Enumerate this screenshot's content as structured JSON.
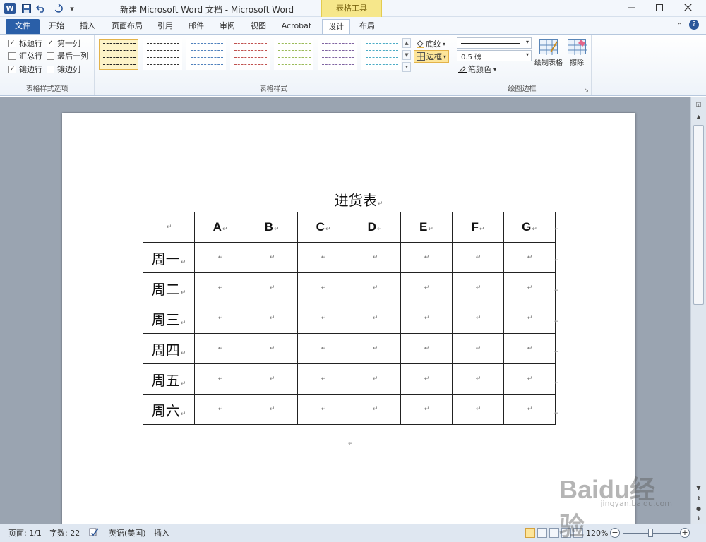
{
  "titlebar": {
    "title": "新建 Microsoft Word 文档 - Microsoft Word",
    "context_tab_group": "表格工具",
    "word_icon": "W",
    "qat_icons": [
      "save-icon",
      "undo-icon",
      "redo-icon",
      "customize-qat-icon"
    ]
  },
  "tabs": {
    "file": "文件",
    "home": "开始",
    "insert": "插入",
    "page_layout": "页面布局",
    "references": "引用",
    "mailings": "邮件",
    "review": "审阅",
    "view": "视图",
    "acrobat": "Acrobat",
    "design": "设计",
    "layout": "布局"
  },
  "ribbon": {
    "table_style_options": {
      "label": "表格样式选项",
      "header_row": {
        "label": "标题行",
        "checked": true
      },
      "first_column": {
        "label": "第一列",
        "checked": true
      },
      "total_row": {
        "label": "汇总行",
        "checked": false
      },
      "last_column": {
        "label": "最后一列",
        "checked": false
      },
      "banded_rows": {
        "label": "镶边行",
        "checked": true
      },
      "banded_columns": {
        "label": "镶边列",
        "checked": false
      }
    },
    "table_styles": {
      "label": "表格样式",
      "swatch_colors": [
        "#222222",
        "#333333",
        "#4f81bd",
        "#c0504d",
        "#9bbb59",
        "#8064a2",
        "#4bacc6"
      ],
      "shading": "底纹",
      "borders": "边框"
    },
    "draw_borders": {
      "label": "绘图边框",
      "line_weight": "0.5 磅",
      "pen_color": "笔颜色",
      "draw_table": "绘制表格",
      "eraser": "擦除"
    }
  },
  "document": {
    "title": "进货表",
    "paragraph_mark": "↵",
    "columns": [
      "",
      "A",
      "B",
      "C",
      "D",
      "E",
      "F",
      "G"
    ],
    "rows": [
      "周一",
      "周二",
      "周三",
      "周四",
      "周五",
      "周六"
    ]
  },
  "statusbar": {
    "page": "页面: 1/1",
    "words": "字数: 22",
    "language": "英语(美国)",
    "mode": "插入",
    "zoom": "120%"
  },
  "watermark": {
    "main": "Baidu经验",
    "sub": "jingyan.baidu.com"
  },
  "colors": {
    "file_tab": "#2a5fa8",
    "context_tab": "#f6e78b",
    "selected_button": "#fde59a",
    "workspace": "#9aa4b1"
  }
}
